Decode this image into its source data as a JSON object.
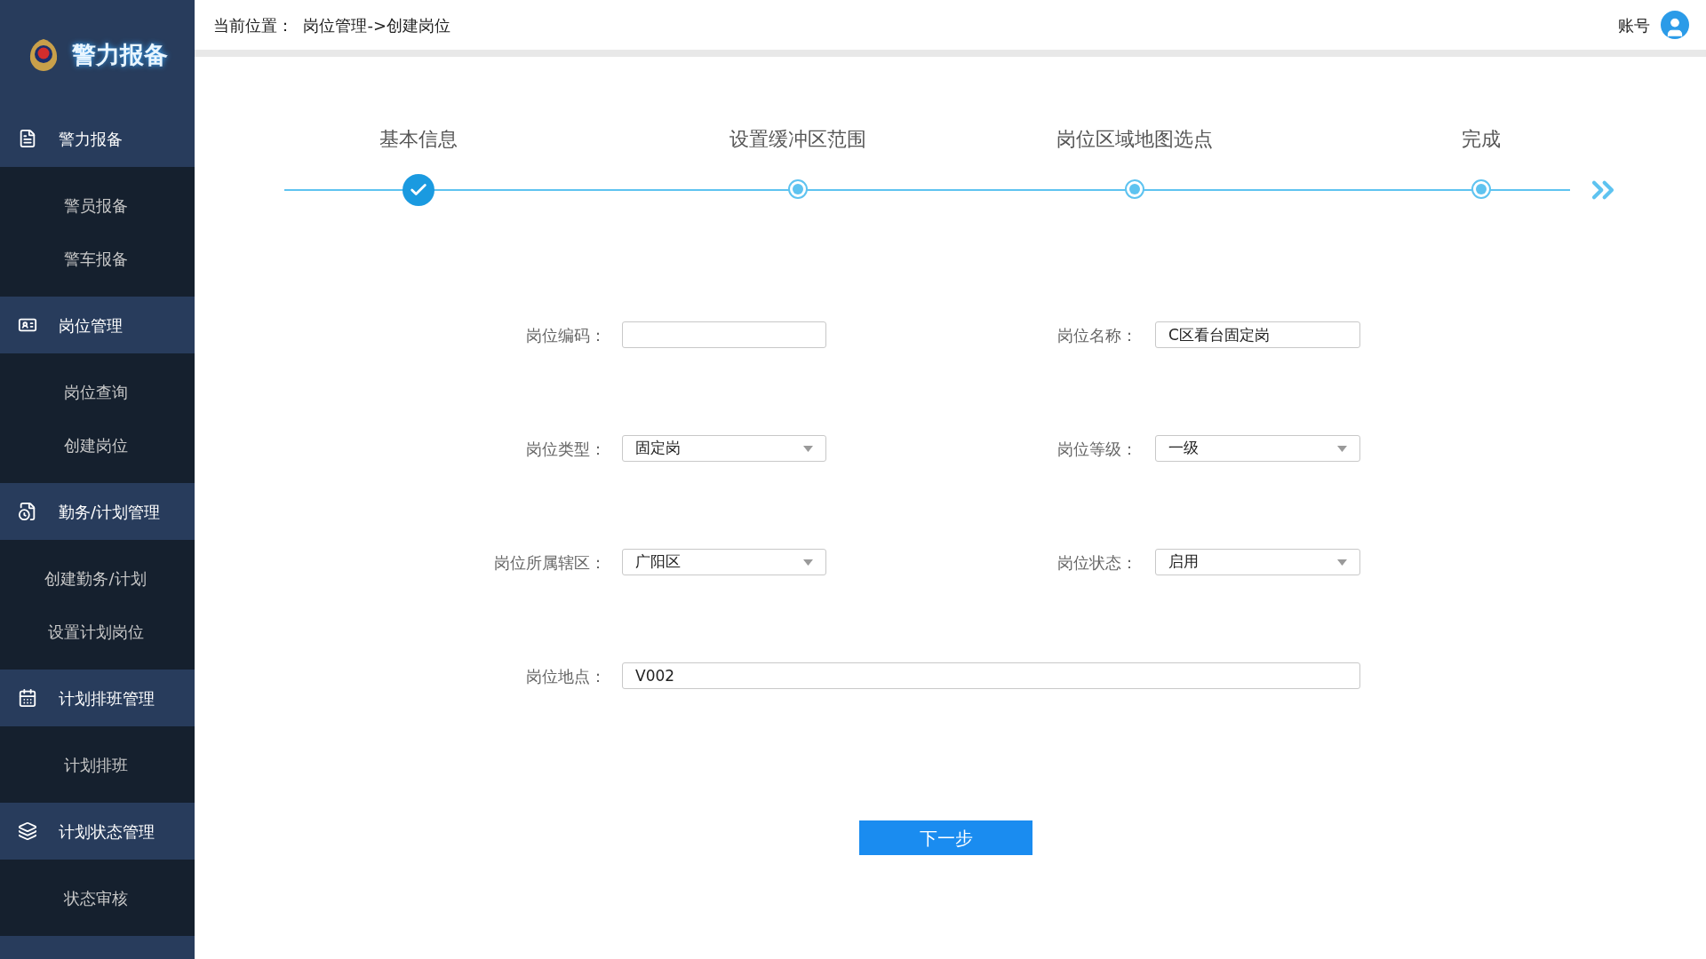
{
  "sidebar": {
    "logo_text": "警力报备",
    "groups": [
      {
        "label": "警力报备",
        "items": [
          "警员报备",
          "警车报备"
        ]
      },
      {
        "label": "岗位管理",
        "items": [
          "岗位查询",
          "创建岗位"
        ]
      },
      {
        "label": "勤务/计划管理",
        "items": [
          "创建勤务/计划",
          "设置计划岗位"
        ]
      },
      {
        "label": "计划排班管理",
        "items": [
          "计划排班"
        ]
      },
      {
        "label": "计划状态管理",
        "items": [
          "状态审核"
        ]
      }
    ]
  },
  "header": {
    "breadcrumb": "当前位置：  岗位管理->创建岗位",
    "account": "账号"
  },
  "steps": [
    {
      "label": "基本信息",
      "completed": true
    },
    {
      "label": "设置缓冲区范围",
      "completed": false
    },
    {
      "label": "岗位区域地图选点",
      "completed": false
    },
    {
      "label": "完成",
      "completed": false
    }
  ],
  "form": {
    "fields": [
      {
        "label": "岗位编码：",
        "kind": "text"
      },
      {
        "label": "岗位名称：",
        "kind": "text",
        "value": "C区看台固定岗"
      },
      {
        "label": "岗位类型：",
        "kind": "select",
        "value": "固定岗"
      },
      {
        "label": "岗位等级：",
        "kind": "select",
        "value": "一级"
      },
      {
        "label": "岗位所属辖区：",
        "kind": "select",
        "value": "广阳区"
      },
      {
        "label": "岗位状态：",
        "kind": "select",
        "value": "启用"
      },
      {
        "label": "岗位地点：",
        "kind": "wide",
        "value": "V002"
      }
    ],
    "next_button": "下一步"
  }
}
